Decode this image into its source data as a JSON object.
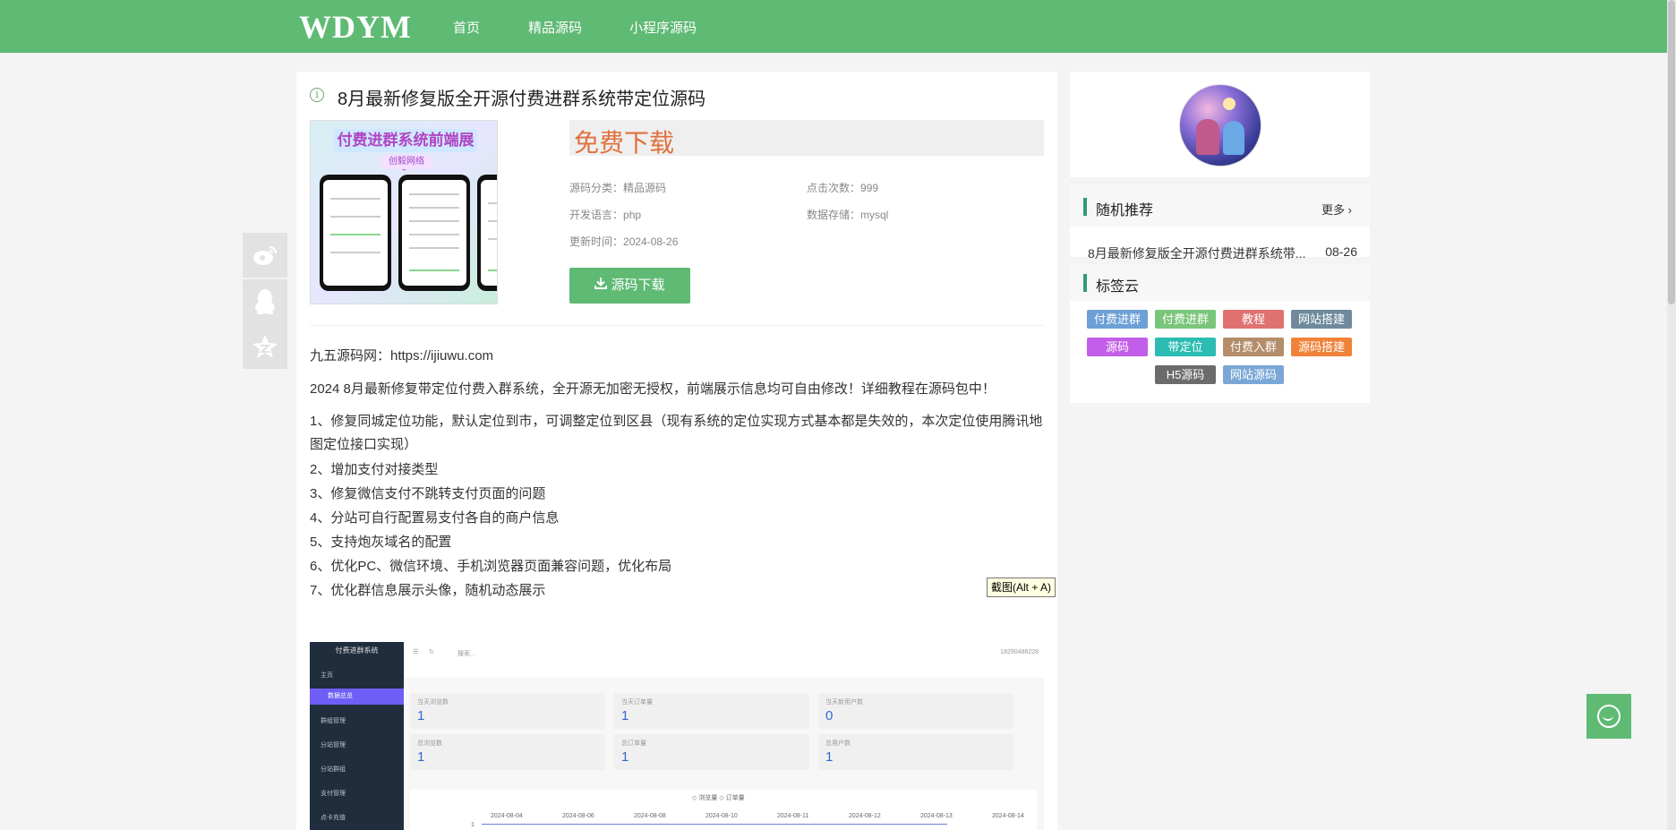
{
  "header": {
    "logo": "WDYM",
    "nav": [
      "首页",
      "精品源码",
      "小程序源码"
    ]
  },
  "article": {
    "title": "8月最新修复版全开源付费进群系统带定位源码",
    "thumb_banner": "付费进群系统前端展示",
    "thumb_sub": "创毅网络",
    "free_label": "免费下载",
    "meta": {
      "category_label": "源码分类：",
      "category_value": "精品源码",
      "clicks_label": "点击次数：",
      "clicks_value": "999",
      "lang_label": "开发语言：",
      "lang_value": "php",
      "db_label": "数据存储：",
      "db_value": "mysql",
      "updated_label": "更新时间：",
      "updated_value": "2024-08-26"
    },
    "download_button": "源码下载",
    "site_line": "九五源码网：https://ijiuwu.com",
    "intro": "2024 8月最新修复带定位付费入群系统，全开源无加密无授权，前端展示信息均可自由修改！详细教程在源码包中！",
    "features": [
      "1、修复同城定位功能，默认定位到市，可调整定位到区县（现有系统的定位实现方式基本都是失效的，本次定位使用腾讯地图定位接口实现）",
      "2、增加支付对接类型",
      "3、修复微信支付不跳转支付页面的问题",
      "4、分站可自行配置易支付各自的商户信息",
      "5、支持炮灰域名的配置",
      "6、优化PC、微信环境、手机浏览器页面兼容问题，优化布局",
      "7、优化群信息展示头像，随机动态展示"
    ],
    "tooltip": "截图(Alt + A)"
  },
  "admin_shot": {
    "brand": "付费进群系统",
    "menu": [
      "主页",
      "数据总览",
      "群组管理",
      "分站管理",
      "分站群组",
      "支付管理",
      "点卡充值"
    ],
    "search": "搜索...",
    "phone": "18290488228",
    "stats": [
      {
        "label": "当天浏览数",
        "value": "1"
      },
      {
        "label": "当天订单量",
        "value": "1"
      },
      {
        "label": "当天新用户数",
        "value": "0"
      },
      {
        "label": "总浏览数",
        "value": "1"
      },
      {
        "label": "总订单量",
        "value": "1"
      },
      {
        "label": "总用户数",
        "value": "1"
      }
    ],
    "legend": "◇ 浏览量  ◇ 订单量",
    "dates": [
      "2024-08-04",
      "2024-08-06",
      "2024-08-08",
      "2024-08-10",
      "2024-08-11",
      "2024-08-12",
      "2024-08-13",
      "2024-08-14"
    ],
    "chart_axis_value": "1"
  },
  "sidebar": {
    "random": {
      "title": "随机推荐",
      "more": "更多",
      "item": "8月最新修复版全开源付费进群系统带...",
      "date": "08-26"
    },
    "tags": {
      "title": "标签云",
      "items": [
        {
          "label": "付费进群",
          "color": "#6ca0d6"
        },
        {
          "label": "付费进群",
          "color": "#79c67a"
        },
        {
          "label": "教程",
          "color": "#e07171"
        },
        {
          "label": "网站搭建",
          "color": "#6f8a9c"
        },
        {
          "label": "源码",
          "color": "#c35ee8"
        },
        {
          "label": "带定位",
          "color": "#2bbcb3"
        },
        {
          "label": "付费入群",
          "color": "#b48d6a"
        },
        {
          "label": "源码搭建",
          "color": "#f0833a"
        },
        {
          "label": "H5源码",
          "color": "#6b6b6b"
        },
        {
          "label": "网站源码",
          "color": "#7aa7d6"
        }
      ]
    }
  },
  "share": [
    "weibo-icon",
    "qq-icon",
    "qzone-icon"
  ]
}
